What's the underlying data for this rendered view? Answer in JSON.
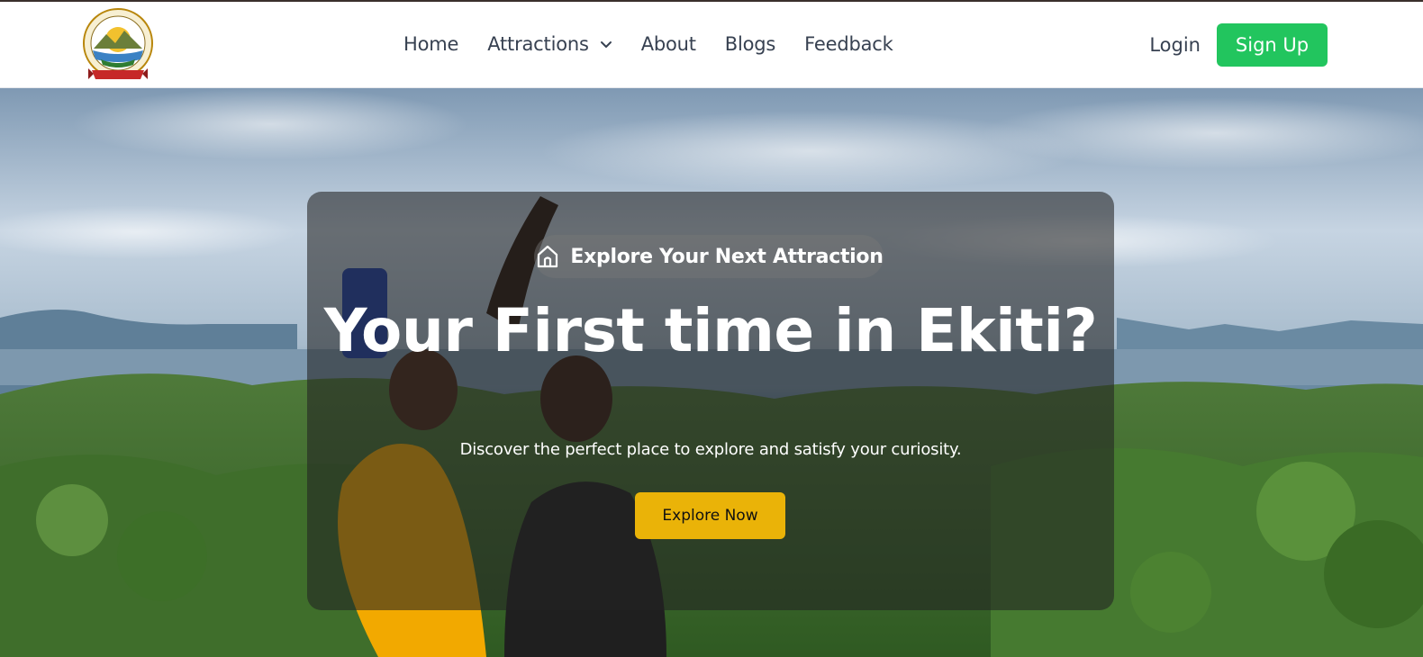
{
  "header": {
    "logo": {
      "alt": "Government of Ekiti State Nigeria seal",
      "icon": "state-seal-logo"
    },
    "nav": [
      {
        "label": "Home"
      },
      {
        "label": "Attractions",
        "has_dropdown": true
      },
      {
        "label": "About"
      },
      {
        "label": "Blogs"
      },
      {
        "label": "Feedback"
      }
    ],
    "login_label": "Login",
    "signup_label": "Sign Up"
  },
  "hero": {
    "badge_icon": "home-icon",
    "badge_text": "Explore Your Next Attraction",
    "title": "Your First time in Ekiti?",
    "subtitle": "Discover the perfect place to explore and satisfy your curiosity.",
    "cta_label": "Explore Now",
    "background": "landscape-photo-two-women-selfie-hilltop"
  },
  "colors": {
    "signup": "#22c55e",
    "cta": "#eab308",
    "nav_text": "#374151",
    "top_strip": "#3a2f2c"
  }
}
